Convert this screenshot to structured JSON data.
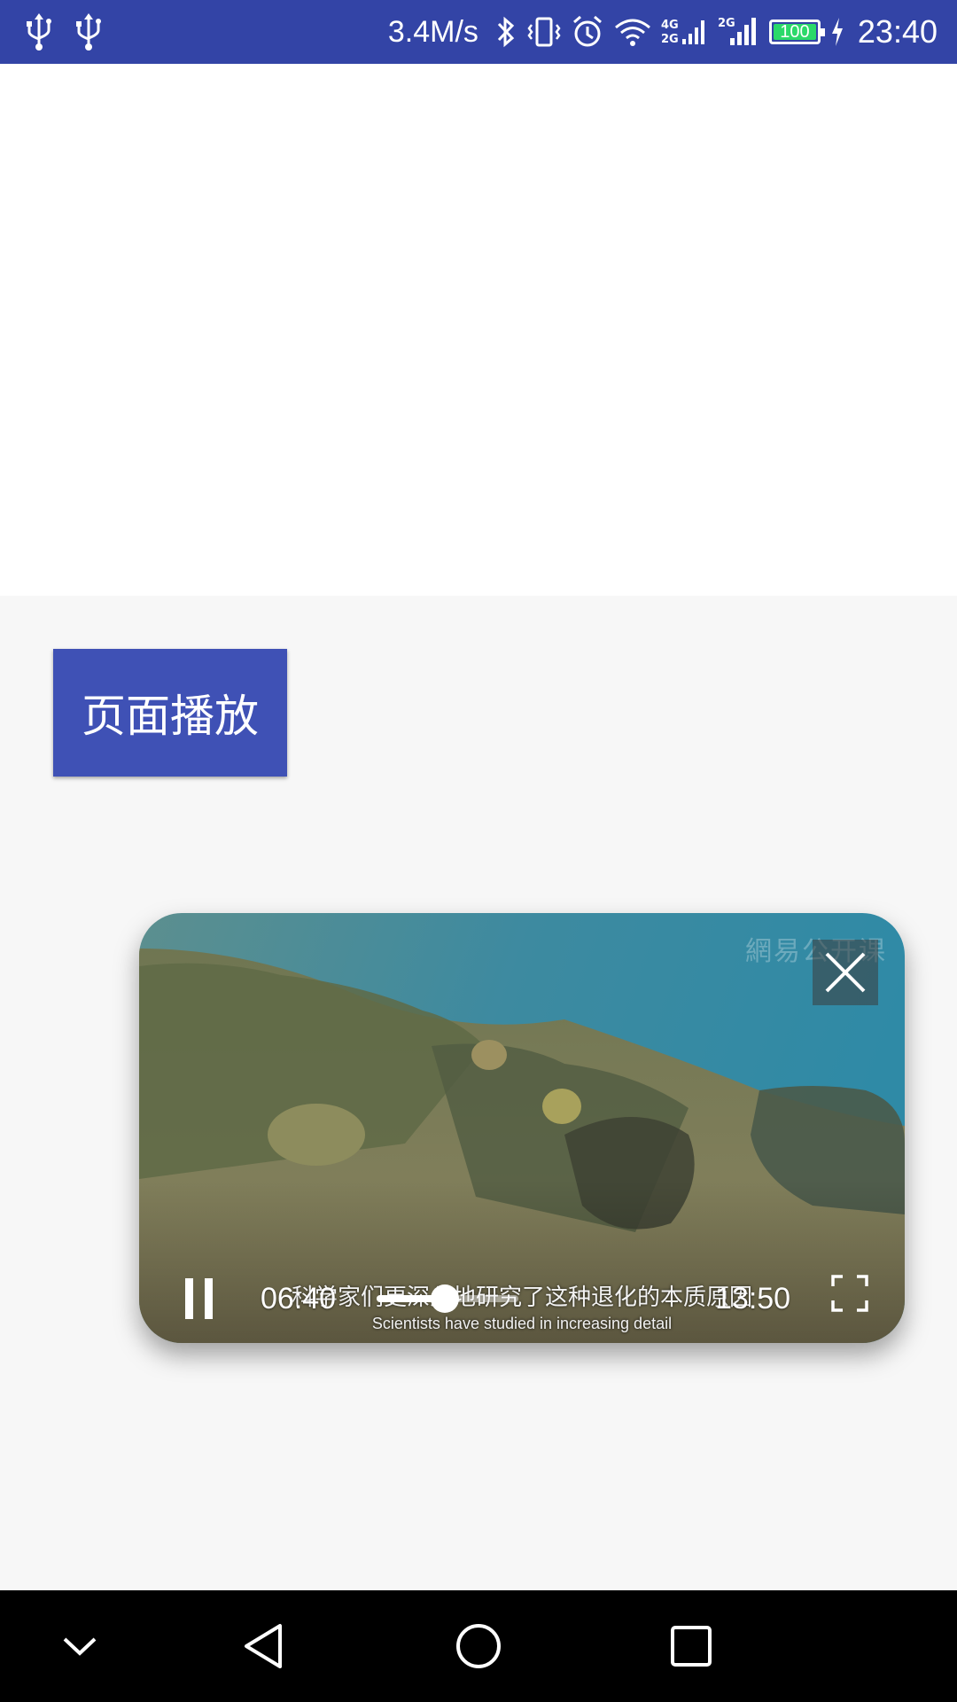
{
  "status_bar": {
    "net_speed": "3.4M/s",
    "battery_level": "100",
    "time": "23:40",
    "left_icons": [
      "usb-icon",
      "usb-icon"
    ],
    "right_icons": [
      "bluetooth-icon",
      "vibrate-icon",
      "alarm-icon",
      "wifi-icon",
      "signal-4g-icon",
      "signal-2g-icon",
      "battery-icon",
      "charging-icon"
    ],
    "background_color": "#3344a6"
  },
  "main": {
    "page_play_button_label": "页面播放",
    "button_color": "#3f51b5"
  },
  "video_player": {
    "watermark": "網易公开课",
    "current_time": "06:40",
    "total_time": "13:50",
    "subtitle_cn": "科学家们更深入地研究了这种退化的本质原因",
    "subtitle_en": "Scientists have studied in increasing detail",
    "progress": 0.48,
    "controls": [
      "pause-icon",
      "close-icon",
      "fullscreen-icon"
    ]
  },
  "nav_bar": {
    "buttons": [
      "chevron-down-icon",
      "back-icon",
      "home-icon",
      "recent-apps-icon"
    ]
  }
}
